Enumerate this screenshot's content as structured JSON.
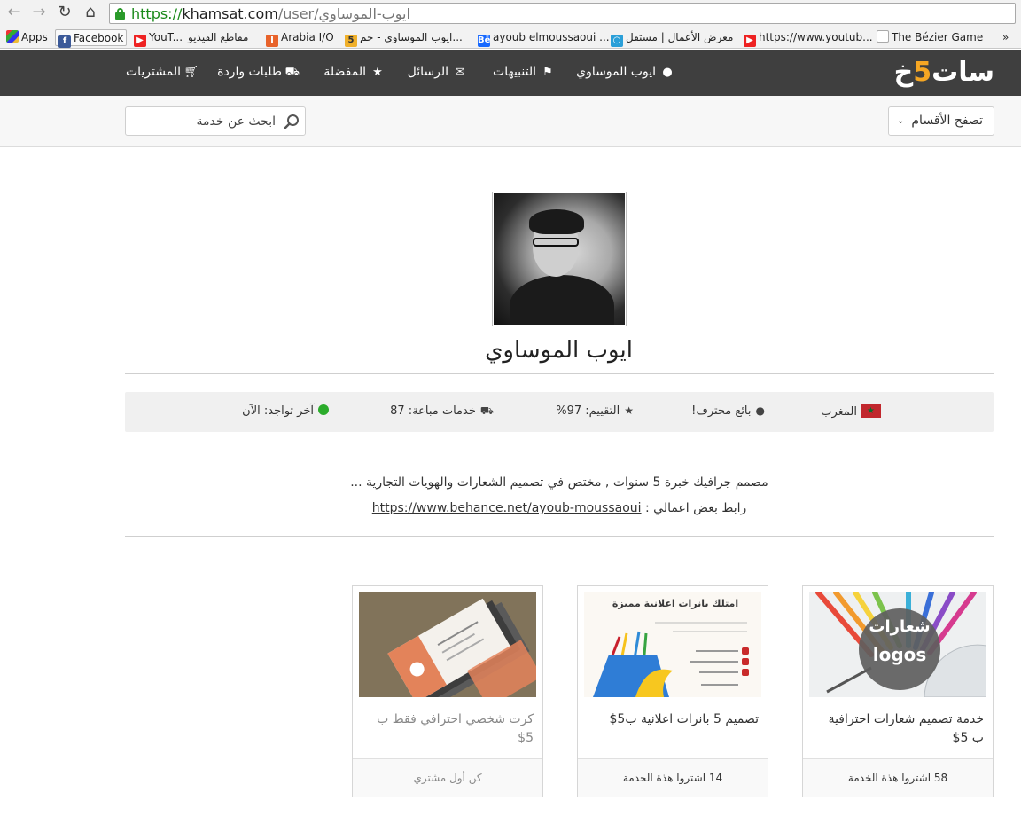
{
  "browser": {
    "url_scheme": "https://",
    "url_host": "khamsat.com",
    "url_path": "/user/ايوب-الموساوي",
    "bookmarks": [
      {
        "label": "Apps"
      },
      {
        "label": "Facebook"
      },
      {
        "label": "YouT..."
      },
      {
        "label": "مقاطع الفيديو"
      },
      {
        "label": "Arabia I/O"
      },
      {
        "label": "ايوب الموساوي - خم..."
      },
      {
        "label": "ayoub elmoussaoui ..."
      },
      {
        "label": "معرض الأعمال | مستقل"
      },
      {
        "label": "https://www.youtub..."
      },
      {
        "label": "The Bézier Game"
      },
      {
        "label": "»"
      }
    ]
  },
  "site": {
    "logo_pre": "خ",
    "logo_five": "5",
    "logo_post": "سات",
    "nav": [
      {
        "label": "ايوب الموساوي",
        "icon": "user-icon"
      },
      {
        "label": "التنبيهات",
        "icon": "flag-icon"
      },
      {
        "label": "الرسائل",
        "icon": "envelope-icon"
      },
      {
        "label": "المفضلة",
        "icon": "star-icon"
      },
      {
        "label": "طلبات واردة",
        "icon": "truck-icon"
      },
      {
        "label": "المشتريات",
        "icon": "cart-icon"
      }
    ],
    "browse_label": "تصفح الأقسام",
    "search_placeholder": "ابحث عن خدمة"
  },
  "profile": {
    "name": "ايوب الموساوي",
    "stats": {
      "country": "المغرب",
      "level": "بائع محترف!",
      "rating": "التقييم: 97%",
      "sold": "خدمات مباعة: 87",
      "last_seen": "آخر تواجد: الآن"
    },
    "bio_line1": "مصمم جرافيك خبرة 5 سنوات , مختص في تصميم الشعارات والهويات التجارية ...",
    "bio_line2_prefix": "رابط بعض اعمالي : ",
    "bio_link": "https://www.behance.net/ayoub-moussaoui"
  },
  "services": [
    {
      "title": "خدمة تصميم شعارات احترافية ب 5$",
      "footer": "58 اشتروا هذة الخدمة",
      "thumb_text_1": "شعارات",
      "thumb_text_2": "logos"
    },
    {
      "title": "تصميم 5 بانرات اعلانية ب5$",
      "footer": "14 اشتروا هذة الخدمة",
      "thumb_text_1": "امتلك بانرات اعلانية مميزة"
    },
    {
      "title": "كرت شخصي احترافي فقط ب 5$",
      "footer": "كن أول مشتري"
    }
  ],
  "colors": {
    "header_bg": "#3f3f3f",
    "logo_accent": "#f5a623",
    "online": "#2bac2b",
    "flag_red": "#c1272d"
  }
}
